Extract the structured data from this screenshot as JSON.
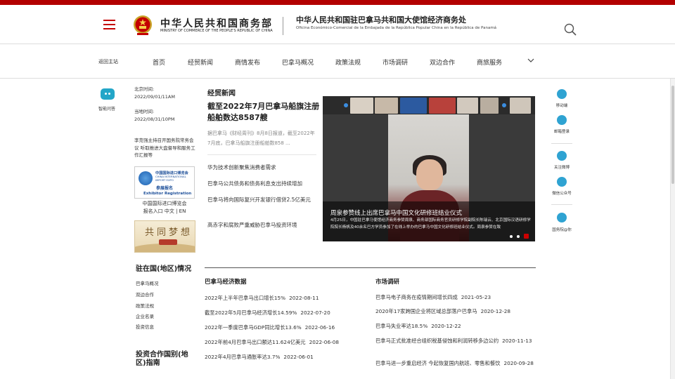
{
  "header": {
    "ministry_cn": "中华人民共和国商务部",
    "ministry_en": "MINISTRY OF COMMERCE OF THE PEOPLE'S REPUBLIC OF CHINA",
    "embassy_cn": "中华人民共和国驻巴拿马共和国大使馆经济商务处",
    "embassy_es": "Oficina Económico-Comercial de la Embajada de la República Popular China en la República de Panamá"
  },
  "nav": {
    "back": "返回主站",
    "items": [
      "首页",
      "经贸新闻",
      "商情发布",
      "巴拿马概况",
      "政策法规",
      "市场调研",
      "双边合作",
      "商旅服务"
    ]
  },
  "left": {
    "robot_label": "智能问答",
    "beijing_time_label": "北京时间:",
    "beijing_time": "2022/09/01/11AM",
    "local_time_label": "当地时间:",
    "local_time": "2022/08/31/10PM",
    "featured_link": "李克强主持召开国务院常务会议 听取推进大盘督导和服务工作汇报等",
    "expo": {
      "cn": "中国国际进口博览会",
      "en": "CHINA INTERNATIONAL IMPORT EXPO",
      "register": "参展报名",
      "register_en": "Exhibitor Registration",
      "caption_line1": "中国国际进口博览会",
      "caption_line2": "报名入口 中文 | EN"
    },
    "dream_banner": "共同梦想",
    "country_section": {
      "title": "驻在国(地区)情况",
      "items": [
        "巴拿马概况",
        "双边合作",
        "政策法规",
        "企业名录",
        "投资信息"
      ]
    },
    "guide_section": {
      "title": "投资合作国别(地区)指南"
    }
  },
  "news": {
    "heading": "经贸新闻",
    "headline": "截至2022年7月巴拿马船旗注册船舶数达8587艘",
    "summary": "据巴拿马《财经周刊》8月8日报道，截至2022年7月底，巴拿马船旗注册船舶数858 ...",
    "links": [
      "华为技术创新聚焦消费者需求",
      "巴拿马公共债务和债务利息支出持续增加",
      "巴拿马将向国际复兴开发银行借贷2.5亿美元",
      "高赤字和腐败严重威胁巴拿马投资环境"
    ]
  },
  "slide": {
    "title": "周泉参赞线上出席巴拿马中国文化研修班结业仪式",
    "desc": "4月25日，中国驻巴拿马使馆经济商务参赞周泉、商务部国际商务官员研修学院副院长陈瑞云、北京国际汉语研修学院院长杨帆及40余名巴方学员参加了在线上举办的巴拿马中国文化研修班结业仪式。周泉参赞在致"
  },
  "right_tools": [
    "移动端",
    "邮箱登录",
    "关注微博",
    "微信公众号",
    "国务院@你"
  ],
  "economy_data": {
    "title": "巴拿马经济数据",
    "items": [
      {
        "text": "2022年上半年巴拿马出口增长15%",
        "date": "2022-08-11"
      },
      {
        "text": "截至2022年5月巴拿马经济增长14.59%",
        "date": "2022-07-20"
      },
      {
        "text": "2022年一季度巴拿马GDP同比增长13.6%",
        "date": "2022-06-16"
      },
      {
        "text": "2022年前4月巴拿马出口额达11.624亿美元",
        "date": "2022-06-08"
      },
      {
        "text": "2022年4月巴拿马通胀率达3.7%",
        "date": "2022-06-01"
      }
    ]
  },
  "market_research": {
    "title": "市场调研",
    "items": [
      {
        "text": "巴拿马电子商务在疫情期间增长四成",
        "date": "2021-05-23"
      },
      {
        "text": "2020年17家跨国企业将区域总部落户巴拿马",
        "date": "2020-12-28"
      },
      {
        "text": "巴拿马失业率达18.5%",
        "date": "2020-12-22"
      },
      {
        "text": "巴拿马正式批准经合组织税基侵蚀和利润转移多边公约",
        "date": "2020-11-13"
      },
      {
        "text": "巴拿马进一步重启经济 今起恢复国内航班、零售和餐饮",
        "date": "2020-09-28"
      }
    ]
  },
  "colors": {
    "brand_red": "#b30000",
    "accent_blue": "#2fa3d2"
  }
}
